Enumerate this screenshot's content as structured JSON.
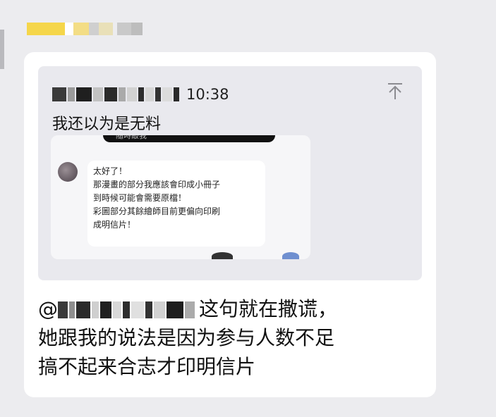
{
  "sender": {
    "name_redacted": true
  },
  "quote": {
    "time": "10:38",
    "text": "我还以为是无料",
    "collapse_icon": "collapse-up-icon",
    "screenshot": {
      "top_caption": "隨時敲我",
      "bubble_lines": [
        "太好了！",
        "那漫畫的部分我應該會印成小冊子",
        "到時候可能會需要原檔！",
        "彩圖部分其餘繪師目前更偏向印刷",
        "成明信片！"
      ]
    }
  },
  "message": {
    "at_symbol": "@",
    "line1": "这句就在撒谎，",
    "line2": "她跟我的说法是因为参与人数不足",
    "line3": "搞不起来合志才印明信片"
  }
}
